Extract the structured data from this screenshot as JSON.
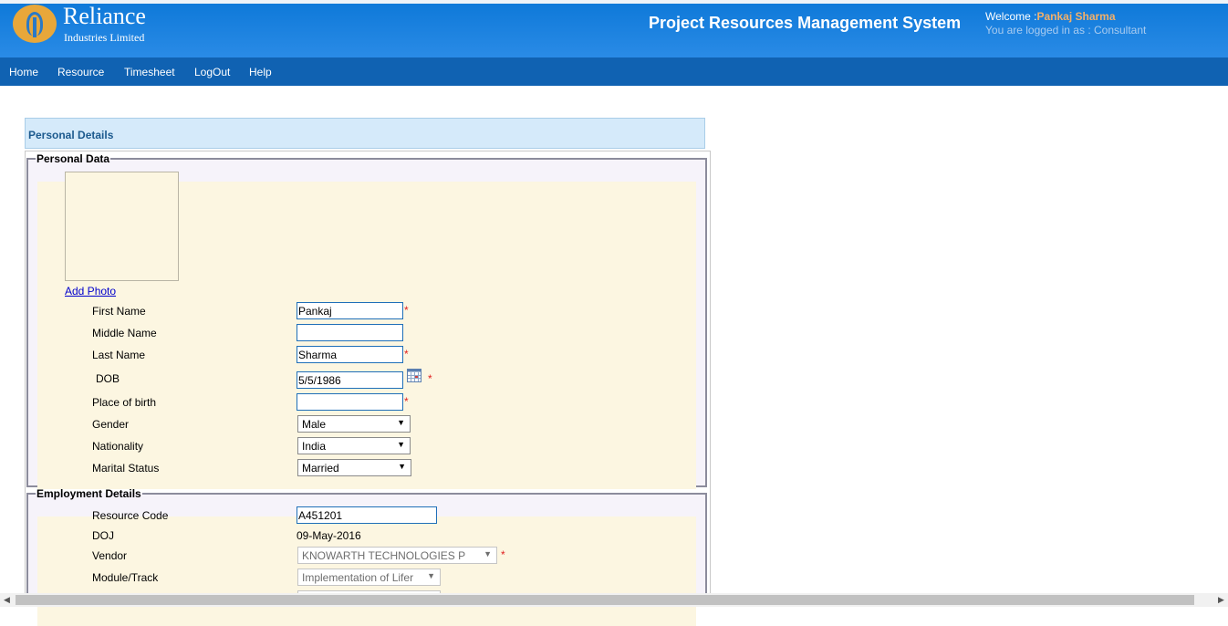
{
  "header": {
    "brand_name": "Reliance",
    "brand_sub": "Industries Limited",
    "app_title": "Project Resources Management System",
    "welcome_label": "Welcome :",
    "user_name": "Pankaj Sharma",
    "logged_in": "You are logged in as : Consultant"
  },
  "nav": {
    "items": [
      "Home",
      "Resource",
      "Timesheet",
      "LogOut",
      "Help"
    ]
  },
  "section": {
    "title": "Personal Details"
  },
  "personal_data": {
    "legend": "Personal Data",
    "add_photo": "Add Photo",
    "first_name": {
      "label": "First Name",
      "value": "Pankaj"
    },
    "middle_name": {
      "label": "Middle Name",
      "value": ""
    },
    "last_name": {
      "label": "Last Name",
      "value": "Sharma"
    },
    "dob": {
      "label": "DOB",
      "value": "5/5/1986"
    },
    "place_of_birth": {
      "label": "Place of birth",
      "value": ""
    },
    "gender": {
      "label": "Gender",
      "value": "Male"
    },
    "nationality": {
      "label": "Nationality",
      "value": "India"
    },
    "marital_status": {
      "label": "Marital Status",
      "value": "Married"
    },
    "required_mark": "*"
  },
  "employment": {
    "legend": "Employment Details",
    "resource_code": {
      "label": "Resource Code",
      "value": "A451201"
    },
    "doj": {
      "label": "DOJ",
      "value": "09-May-2016"
    },
    "vendor": {
      "label": "Vendor",
      "value": "KNOWARTH TECHNOLOGIES P"
    },
    "module_track": {
      "label": "Module/Track",
      "value": "Implementation of Lifer"
    }
  },
  "colors": {
    "header_blue": "#1a80df",
    "nav_blue": "#1062b2",
    "user_name": "#f2b06a",
    "required": "#e02020",
    "panel_bg": "#fcf6e1"
  }
}
